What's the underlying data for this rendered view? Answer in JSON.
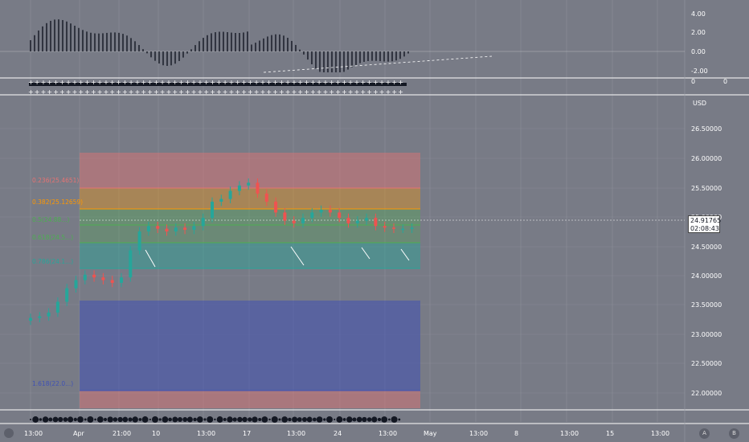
{
  "price_axis": {
    "currency": "USD",
    "ticks": [
      "26.50000",
      "26.00000",
      "25.50000",
      "25.00000",
      "24.50000",
      "24.00000",
      "23.50000",
      "23.00000",
      "22.50000",
      "22.00000"
    ],
    "last_price": "24.91765",
    "countdown": "02:08:43"
  },
  "oscillator_axis": {
    "ticks": [
      "4.00",
      "2.00",
      "0.00",
      "-2.00"
    ]
  },
  "signal_axis": {
    "ticks": [
      "0",
      "0"
    ]
  },
  "time_axis": {
    "labels": [
      "13:00",
      "Apr",
      "21:00",
      "10",
      "13:00",
      "17",
      "13:00",
      "24",
      "13:00",
      "May",
      "13:00",
      "8",
      "13:00",
      "15",
      "13:00"
    ]
  },
  "footer_buttons": {
    "left": "",
    "auto": "A",
    "scale": "B"
  },
  "fib_levels": [
    {
      "label": "0.236(25.4651)"
    },
    {
      "label": "0.382(25.12659)"
    },
    {
      "label": "0.5(24.88...)"
    },
    {
      "label": "0.618(24.5...)"
    },
    {
      "label": "0.786(24.1...)"
    },
    {
      "label": "1.618(22.0...)"
    }
  ],
  "colors": {
    "background": "#787b86",
    "up_candle": "#26a69a",
    "down_candle": "#ef5350",
    "fib_red": "#e57373",
    "fib_orange": "#ff9800",
    "fib_green": "#4caf50",
    "fib_teal": "#26a69a",
    "fib_blue": "#3f51b5"
  },
  "chart_data": {
    "type": "candlestick",
    "ylim": [
      21.7,
      26.9
    ],
    "series": [
      {
        "name": "price",
        "close": [
          23.25,
          23.28,
          23.35,
          23.55,
          23.8,
          23.95,
          24.05,
          24.0,
          23.95,
          23.9,
          24.0,
          24.5,
          24.85,
          24.95,
          24.9,
          24.85,
          24.92,
          24.88,
          24.95,
          25.1,
          25.4,
          25.45,
          25.6,
          25.7,
          25.75,
          25.55,
          25.4,
          25.2,
          25.05,
          25.0,
          25.1,
          25.2,
          25.25,
          25.2,
          25.1,
          25.0,
          25.05,
          25.1,
          24.95,
          24.92,
          24.9,
          24.9,
          24.92
        ]
      }
    ]
  }
}
